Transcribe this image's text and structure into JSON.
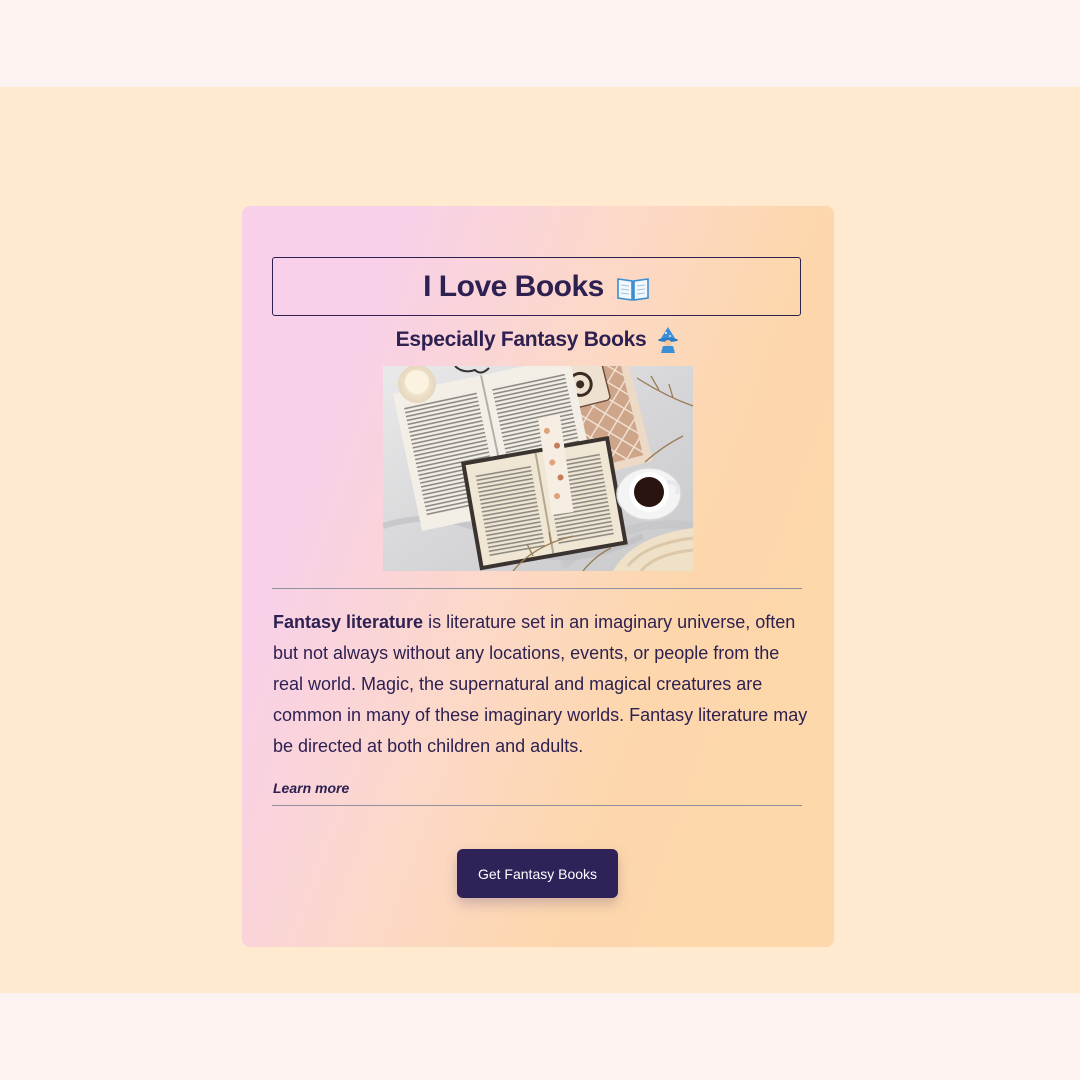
{
  "card": {
    "title": "I Love Books",
    "title_icon": "open-book-icon",
    "subtitle": "Especially Fantasy Books",
    "subtitle_icon": "mage-icon",
    "image_alt": "Open books with a bookmark, candle and cup of coffee on white linen",
    "description_lead": "Fantasy literature",
    "description_rest": " is literature set in an imaginary universe, often but not always without any locations, events, or people from the real world. Magic, the supernatural and magical creatures are common in many of these imaginary worlds. Fantasy literature may be directed at both children and adults.",
    "learn_more": "Learn more",
    "button_label": "Get Fantasy Books"
  },
  "colors": {
    "page_bg": "#fcf2ef",
    "band_bg": "#ffead0",
    "text": "#2e2152",
    "button_bg": "#2f2259"
  }
}
